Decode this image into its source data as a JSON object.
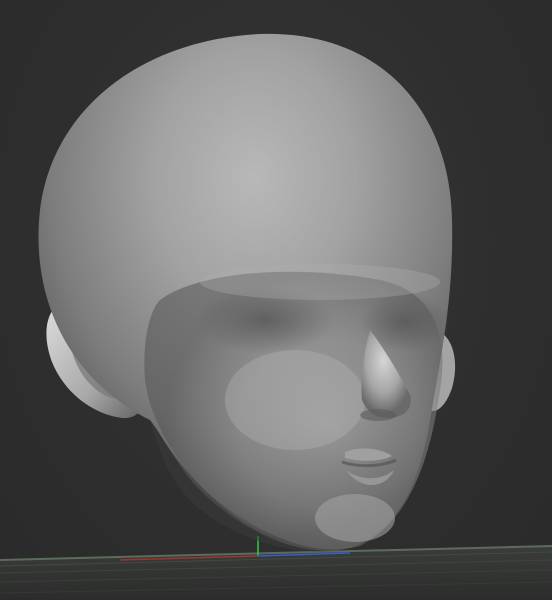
{
  "viewport": {
    "background_color": "#2f2f2f",
    "model": {
      "type": "sculpt-head",
      "material_color": "#9a9a9a"
    },
    "floor_grid": {
      "visible": true,
      "line_color": "#5c6b5c"
    },
    "axis_gizmo": {
      "x_axis_color": "#c0392b",
      "y_axis_color": "#2ecc40",
      "z_axis_color": "#2f5fd0"
    }
  }
}
